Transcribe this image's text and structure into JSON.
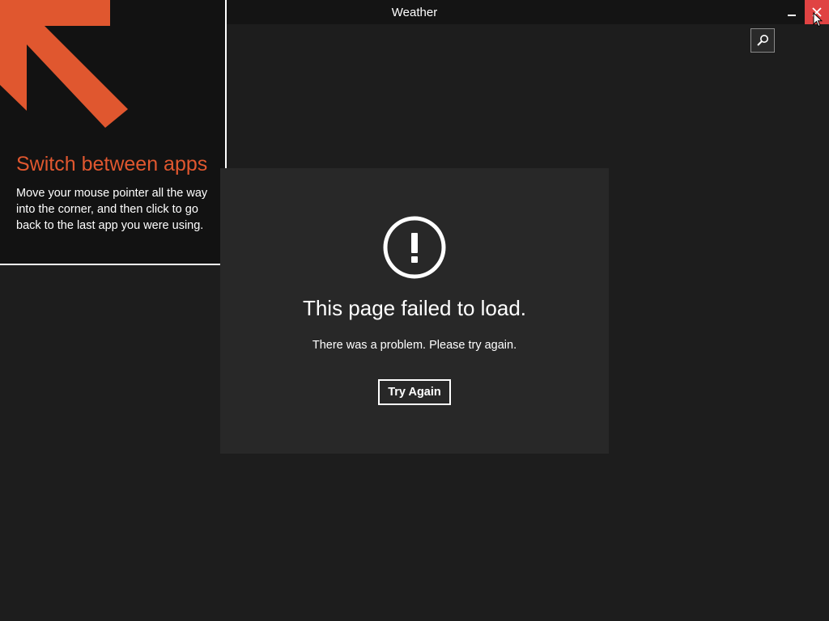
{
  "window": {
    "title": "Weather",
    "close_color": "#e04343"
  },
  "icons": {
    "search": "search-icon",
    "close": "close-icon",
    "minimize": "minimize-icon",
    "error": "exclamation-circle-icon",
    "corner_arrow": "arrow-up-left-icon",
    "cursor": "mouse-pointer-icon"
  },
  "tip": {
    "title": "Switch between apps",
    "body": "Move your mouse pointer all the way into the corner, and then click to go back to the last app you were using.",
    "accent_color": "#e0572f"
  },
  "error": {
    "title": "This page failed to load.",
    "message": "There was a problem. Please try again.",
    "button_label": "Try Again"
  },
  "colors": {
    "background": "#1d1d1d",
    "panel": "#282828",
    "titlebar": "#141414",
    "tip_background": "#121212"
  }
}
